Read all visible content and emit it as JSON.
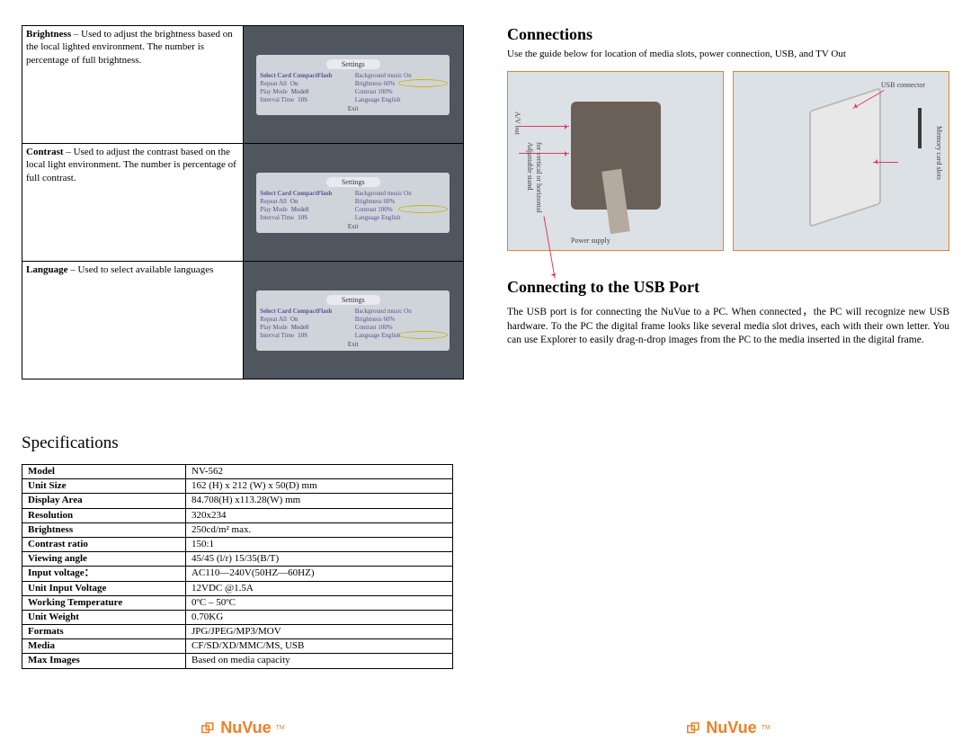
{
  "left": {
    "rows": [
      {
        "term": "Brightness",
        "desc": " – Used to adjust the brightness based on the local lighted environment. The number is percentage of full brightness.",
        "highlight": "brightness"
      },
      {
        "term": "Contrast",
        "desc": " – Used to adjust the contrast based on the local light environment. The number is percentage of full contrast.",
        "highlight": "contrast"
      },
      {
        "term": "Language",
        "desc": " – Used to select available languages",
        "highlight": "language"
      }
    ],
    "device": {
      "title": "Settings",
      "selectCard": "Select Card  CompactFlash",
      "bgMusic": "Background music On",
      "repeat": "Repeat All",
      "repeatVal": "On",
      "bright": "Brightness 60%",
      "playMode": "Play Mode",
      "playModeVal": "Mode8",
      "contrast": "Contrast 100%",
      "interval": "Interval Time",
      "intervalVal": "10S",
      "language": "Language  English",
      "exit": "Exit"
    },
    "specHeading": "Specifications",
    "specs": [
      {
        "k": "Model",
        "v": "NV-562"
      },
      {
        "k": "Unit Size",
        "v": "162 (H) x 212 (W) x 50(D) mm"
      },
      {
        "k": "Display Area",
        "v": "84.708(H) x113.28(W) mm"
      },
      {
        "k": "Resolution",
        "v": "320x234"
      },
      {
        "k": "Brightness",
        "v": "250cd/m² max."
      },
      {
        "k": "Contrast ratio",
        "v": "150:1"
      },
      {
        "k": "Viewing angle",
        "v": "45/45 (l/r) 15/35(B/T)"
      },
      {
        "k": "Input voltage：",
        "v": "AC110—240V(50HZ—60HZ)"
      },
      {
        "k": "Unit Input Voltage",
        "v": "12VDC @1.5A"
      },
      {
        "k": "Working Temperature",
        "v": "0ºC – 50ºC"
      },
      {
        "k": "Unit Weight",
        "v": "0.70KG"
      },
      {
        "k": "Formats",
        "v": " JPG/JPEG/MP3/MOV"
      },
      {
        "k": "Media",
        "v": "CF/SD/XD/MMC/MS, USB"
      },
      {
        "k": "Max Images",
        "v": "Based on media capacity"
      }
    ]
  },
  "right": {
    "connHeading": "Connections",
    "connSub": "Use the guide below for location of media slots, power connection, USB, and TV Out",
    "labels": {
      "av": "A/V out",
      "stand": "Adjustable stand",
      "stand2": "for vertical or horizontal",
      "usb": "USB connector",
      "mem": "Memory card slots",
      "power": "Power supply"
    },
    "usbHeading": "Connecting to the USB Port",
    "usbPara": "The USB port is for connecting the NuVue to a PC. When connected，the PC will recognize new USB hardware. To the PC the digital frame looks like several media slot drives, each with their own letter. You can use Explorer to easily drag-n-drop images from the PC to the media inserted in the digital frame."
  },
  "logo": "NuVue",
  "tm": "TM"
}
